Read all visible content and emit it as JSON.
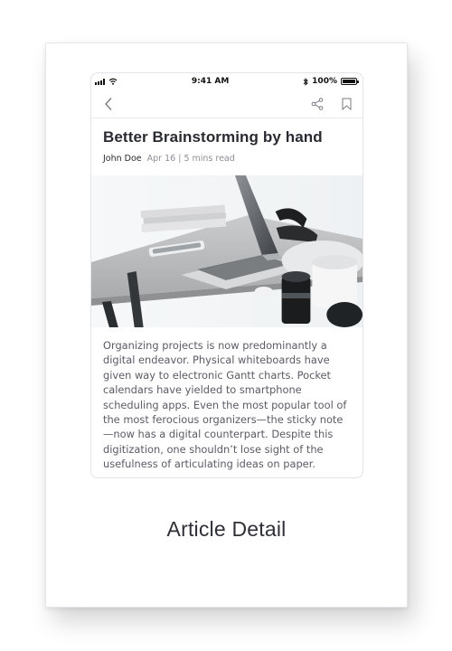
{
  "status_bar": {
    "time": "9:41 AM",
    "battery": "100%"
  },
  "article": {
    "title": "Better Brainstorming by hand",
    "author": "John Doe",
    "info": "Apr 16 | 5 mins read",
    "body": "Organizing projects is now predominantly a digital endeavor. Physical whiteboards have given way to electronic Gantt charts. Pocket calendars have yielded to smartphone scheduling apps. Even the most popular tool of the most ferocious organizers—the sticky note—now has a digital counterpart. Despite this digitization, one shouldn’t lose sight of the usefulness of articulating ideas on paper."
  },
  "caption": "Article Detail",
  "icons": {
    "back": "chevron-left-icon",
    "share": "share-icon",
    "bookmark": "bookmark-icon"
  },
  "colors": {
    "title": "#2a2a33",
    "body": "#5b5b66",
    "meta": "#8d8d96",
    "icon": "#7b7b85"
  }
}
